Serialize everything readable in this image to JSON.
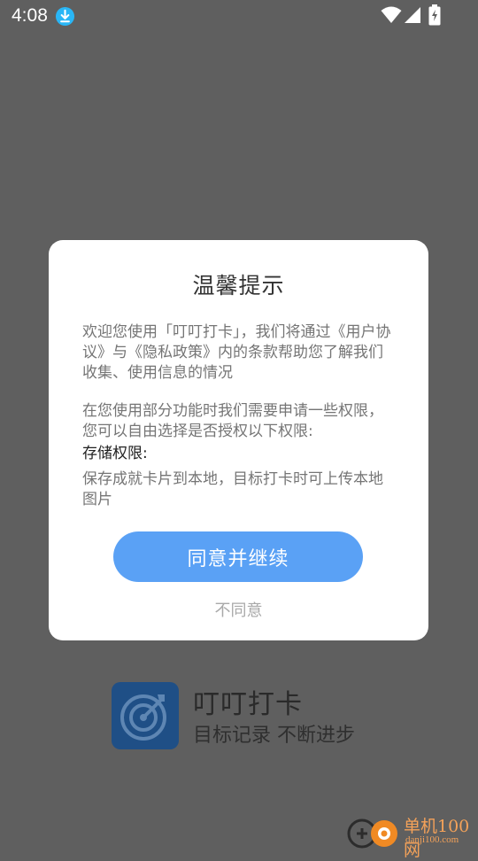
{
  "status_bar": {
    "time": "4:08"
  },
  "dialog": {
    "title": "温馨提示",
    "paragraph_1": "欢迎您使用「叮叮打卡」，我们将通过《用户协议》与《隐私政策》内的条款帮助您了解我们收集、使用信息的情况",
    "paragraph_2": "在您使用部分功能时我们需要申请一些权限，您可以自由选择是否授权以下权限:",
    "permission_title": "存储权限:",
    "permission_desc": "保存成就卡片到本地，目标打卡时可上传本地图片",
    "agree_label": "同意并继续",
    "disagree_label": "不同意"
  },
  "app": {
    "name": "叮叮打卡",
    "slogan": "目标记录 不断进步"
  },
  "watermark": {
    "cn": "单机100网",
    "en": "danji100.com"
  },
  "colors": {
    "accent": "#5aa1f5",
    "overlay": "#5f5f5f",
    "logo": "#1f4f86",
    "watermark": "#f4a259"
  },
  "icons": [
    "download-icon",
    "wifi-icon",
    "signal-icon",
    "battery-icon",
    "target-icon"
  ]
}
